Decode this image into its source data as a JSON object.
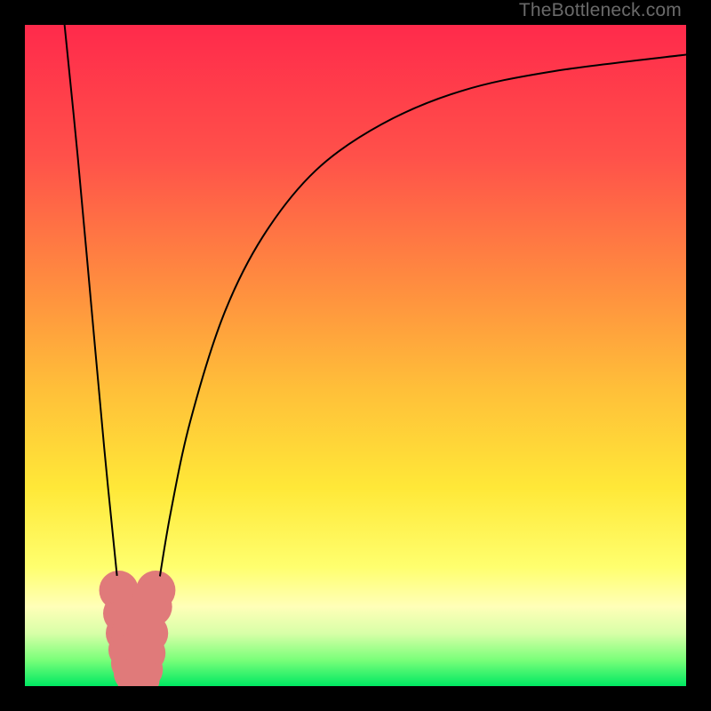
{
  "watermark": "TheBottleneck.com",
  "chart_data": {
    "type": "line",
    "title": "",
    "xlabel": "",
    "ylabel": "",
    "xlim": [
      0,
      100
    ],
    "ylim": [
      0,
      100
    ],
    "gradient_stops": [
      {
        "offset": 0,
        "color": "#ff2a4b"
      },
      {
        "offset": 0.2,
        "color": "#ff514a"
      },
      {
        "offset": 0.4,
        "color": "#ff8f3f"
      },
      {
        "offset": 0.55,
        "color": "#ffbf39"
      },
      {
        "offset": 0.7,
        "color": "#ffe838"
      },
      {
        "offset": 0.82,
        "color": "#ffff6e"
      },
      {
        "offset": 0.88,
        "color": "#ffffb8"
      },
      {
        "offset": 0.92,
        "color": "#d8ffa8"
      },
      {
        "offset": 0.96,
        "color": "#7bff7a"
      },
      {
        "offset": 1.0,
        "color": "#00e862"
      }
    ],
    "series": [
      {
        "name": "left-branch",
        "x": [
          6.0,
          8.0,
          10.0,
          12.0,
          14.0,
          15.0,
          16.0,
          16.5
        ],
        "y": [
          100.0,
          80.0,
          58.0,
          36.0,
          16.0,
          8.0,
          3.0,
          0.5
        ]
      },
      {
        "name": "right-branch",
        "x": [
          17.5,
          18.5,
          20.0,
          22.0,
          25.0,
          30.0,
          36.0,
          44.0,
          54.0,
          66.0,
          80.0,
          100.0
        ],
        "y": [
          0.5,
          5.0,
          14.0,
          26.0,
          40.0,
          56.0,
          68.0,
          78.0,
          85.0,
          90.0,
          93.0,
          95.5
        ]
      }
    ],
    "markers": {
      "name": "dip-cluster",
      "color": "#e07a7a",
      "radius": 2.2,
      "points": [
        {
          "x": 14.2,
          "y": 14.5
        },
        {
          "x": 14.8,
          "y": 11.0
        },
        {
          "x": 15.2,
          "y": 8.0
        },
        {
          "x": 15.6,
          "y": 5.5
        },
        {
          "x": 16.0,
          "y": 3.5
        },
        {
          "x": 16.4,
          "y": 2.0
        },
        {
          "x": 16.9,
          "y": 1.0
        },
        {
          "x": 17.4,
          "y": 1.0
        },
        {
          "x": 17.9,
          "y": 2.5
        },
        {
          "x": 18.3,
          "y": 5.0
        },
        {
          "x": 18.7,
          "y": 8.0
        },
        {
          "x": 19.3,
          "y": 12.0
        },
        {
          "x": 19.8,
          "y": 14.5
        }
      ]
    }
  }
}
